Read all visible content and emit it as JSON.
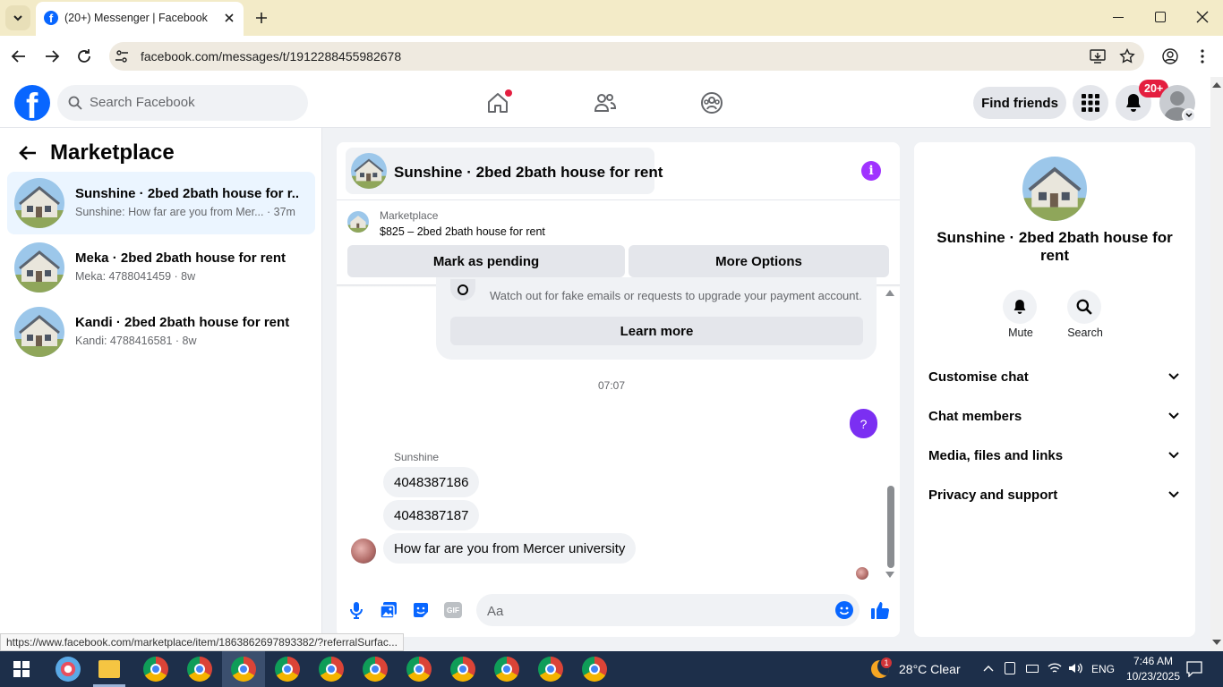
{
  "browser": {
    "tab_title": "(20+) Messenger | Facebook",
    "url": "facebook.com/messages/t/1912288455982678",
    "status_url": "https://www.facebook.com/marketplace/item/1863862697893382/?referralSurfac..."
  },
  "header": {
    "search_placeholder": "Search Facebook",
    "find_friends_label": "Find friends",
    "notification_badge": "20+"
  },
  "sidebar": {
    "title": "Marketplace",
    "conversations": [
      {
        "name": "Sunshine · 2bed 2bath house for r...",
        "preview": "Sunshine: How far are you from Mer... · 37m",
        "active": true
      },
      {
        "name": "Meka · 2bed 2bath house for rent",
        "preview": "Meka: 4788041459 · 8w",
        "active": false
      },
      {
        "name": "Kandi · 2bed 2bath house for rent",
        "preview": "Kandi: 4788416581 · 8w",
        "active": false
      }
    ]
  },
  "chat": {
    "title": "Sunshine · 2bed 2bath house for rent",
    "marketplace_label": "Marketplace",
    "listing": "$825 – 2bed 2bath house for rent",
    "mark_pending_label": "Mark as pending",
    "more_options_label": "More Options",
    "warning_text": "Watch out for fake emails or requests to upgrade your payment account.",
    "learn_more_label": "Learn more",
    "timestamp": "07:07",
    "outgoing_message": "?",
    "sender_name": "Sunshine",
    "messages": [
      "4048387186",
      "4048387187",
      "How far are you from Mercer university"
    ],
    "composer_placeholder": "Aa",
    "gif_label": "GIF"
  },
  "details": {
    "title": "Sunshine · 2bed 2bath house for rent",
    "mute_label": "Mute",
    "search_label": "Search",
    "sections": [
      "Customise chat",
      "Chat members",
      "Media, files and links",
      "Privacy and support"
    ]
  },
  "taskbar": {
    "weather_badge": "1",
    "weather": "28°C  Clear",
    "lang": "ENG",
    "time": "7:46 AM",
    "date": "10/23/2025"
  },
  "colors": {
    "fb_blue": "#0866ff",
    "messenger_purple": "#a033ff",
    "notification_red": "#e41e3f",
    "active_row": "#ebf5ff"
  }
}
